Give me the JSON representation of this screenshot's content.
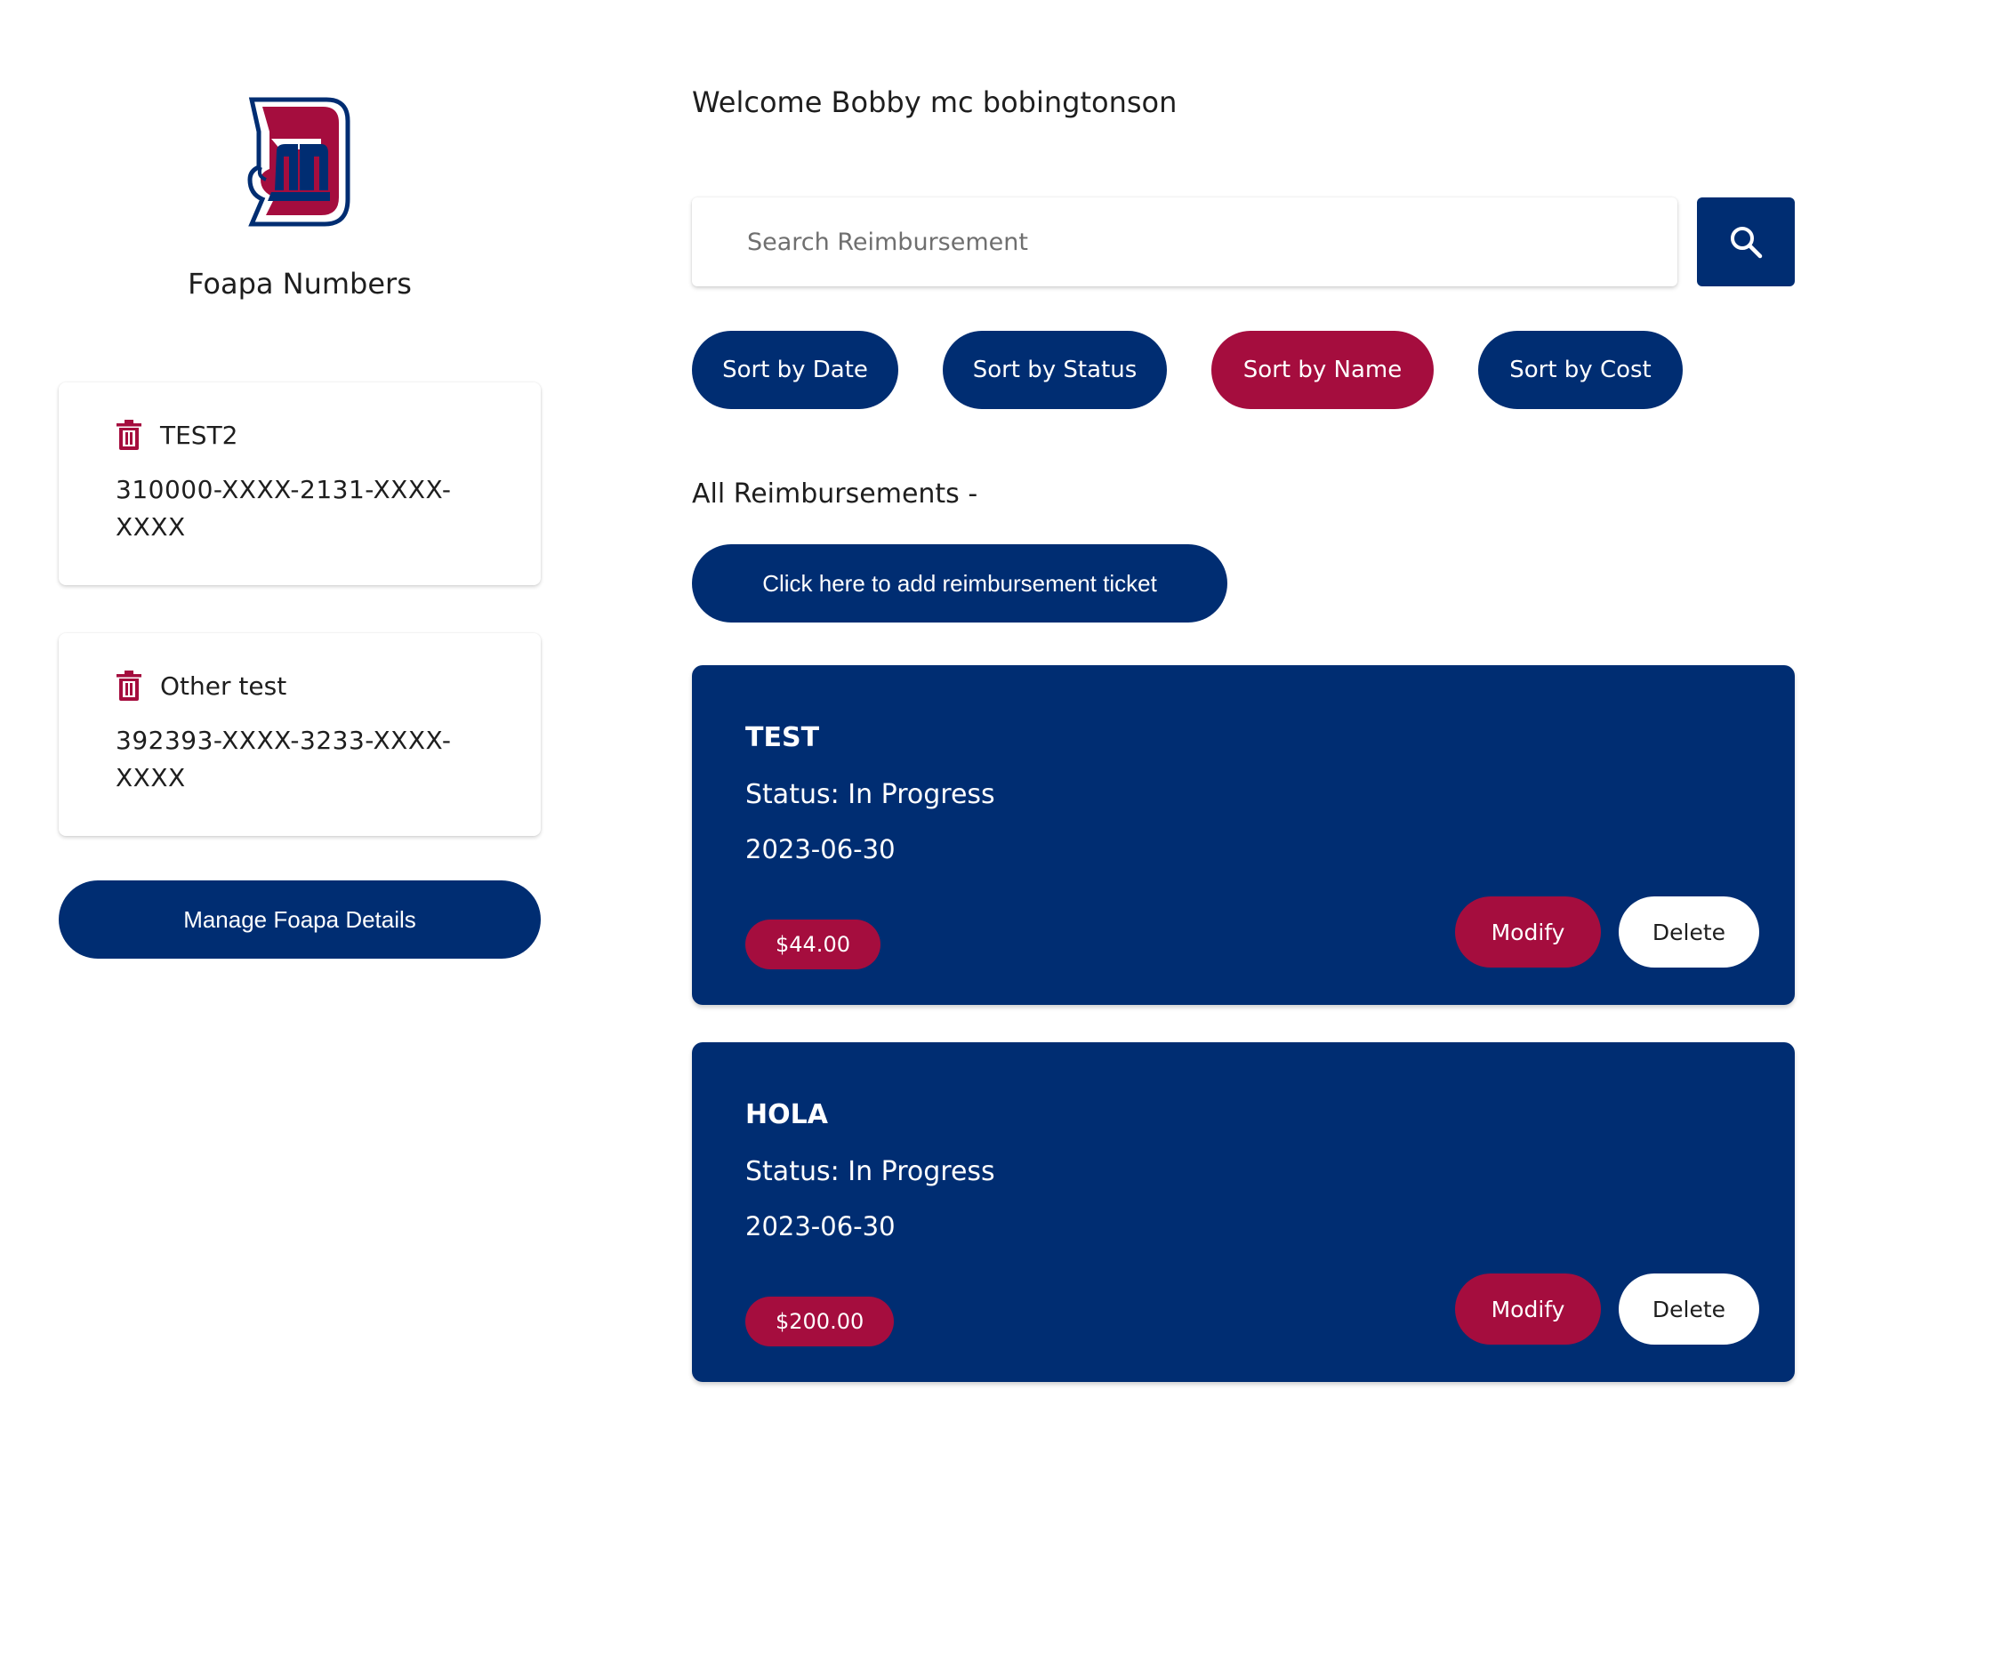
{
  "colors": {
    "primary": "#002d72",
    "accent": "#a50d3e",
    "white": "#ffffff"
  },
  "sidebar": {
    "logo_icon": "detroit-mercy-d-logo",
    "title": "Foapa Numbers",
    "foapas": [
      {
        "name": "TEST2",
        "number": "310000-XXXX-2131-XXXX-XXXX",
        "icon": "trash-icon"
      },
      {
        "name": "Other test",
        "number": "392393-XXXX-3233-XXXX-XXXX",
        "icon": "trash-icon"
      }
    ],
    "manage_label": "Manage Foapa Details"
  },
  "header": {
    "welcome": "Welcome Bobby mc bobingtonson"
  },
  "search": {
    "placeholder": "Search Reimbursement",
    "value": "",
    "icon": "search-icon"
  },
  "sort": {
    "buttons": [
      {
        "label": "Sort by Date",
        "active": false
      },
      {
        "label": "Sort by Status",
        "active": false
      },
      {
        "label": "Sort by Name",
        "active": true
      },
      {
        "label": "Sort by Cost",
        "active": false
      }
    ]
  },
  "list": {
    "title": "All Reimbursements -",
    "add_label": "Click here to add reimbursement ticket",
    "tickets": [
      {
        "name": "TEST",
        "status": "Status: In Progress",
        "date": "2023-06-30",
        "cost": "$44.00",
        "modify_label": "Modify",
        "delete_label": "Delete"
      },
      {
        "name": "HOLA",
        "status": "Status: In Progress",
        "date": "2023-06-30",
        "cost": "$200.00",
        "modify_label": "Modify",
        "delete_label": "Delete"
      }
    ]
  }
}
